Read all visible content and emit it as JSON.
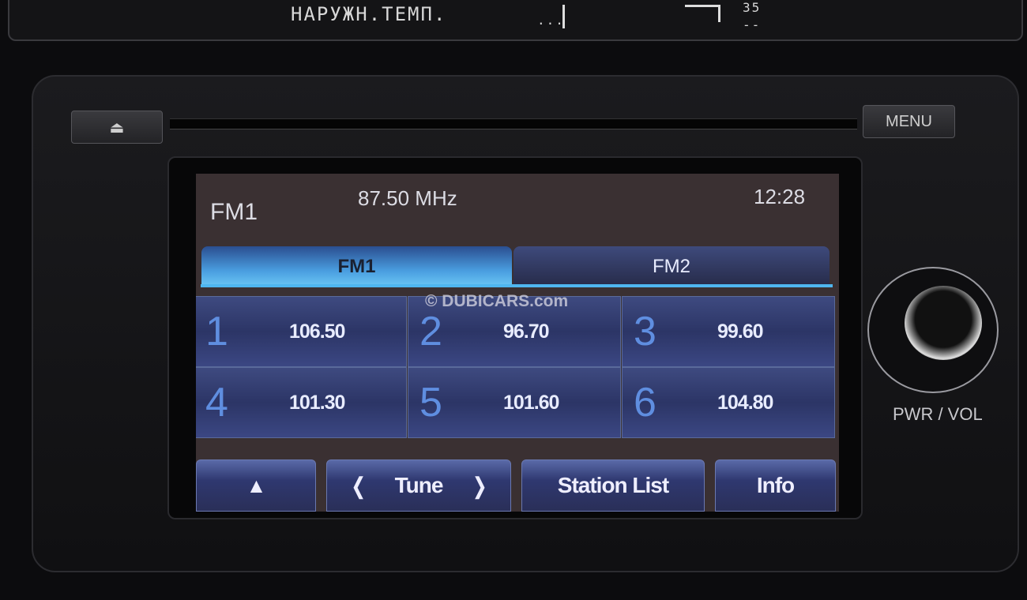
{
  "top_display": {
    "label": "НАРУЖН.ТЕМП.",
    "value_a": "...",
    "value_b": "35",
    "value_c": "--"
  },
  "hardware": {
    "eject_icon": "eject-icon",
    "menu_label": "MENU",
    "knob_label": "PWR / VOL"
  },
  "screen": {
    "band": "FM1",
    "frequency": "87.50 MHz",
    "clock": "12:28",
    "tabs": [
      {
        "label": "FM1",
        "active": true
      },
      {
        "label": "FM2",
        "active": false
      }
    ],
    "presets": [
      {
        "num": "1",
        "freq": "106.50"
      },
      {
        "num": "2",
        "freq": "96.70"
      },
      {
        "num": "3",
        "freq": "99.60"
      },
      {
        "num": "4",
        "freq": "101.30"
      },
      {
        "num": "5",
        "freq": "101.60"
      },
      {
        "num": "6",
        "freq": "104.80"
      }
    ],
    "buttons": {
      "up_icon": "triangle-up-icon",
      "tune_prev": "❬",
      "tune": "Tune",
      "tune_next": "❭",
      "station_list": "Station List",
      "info": "Info"
    },
    "watermark": "© DUBICARS.com"
  },
  "colors": {
    "accent": "#4fb6ef",
    "preset_bg": "#2c3566",
    "number": "#5f8ee0"
  }
}
